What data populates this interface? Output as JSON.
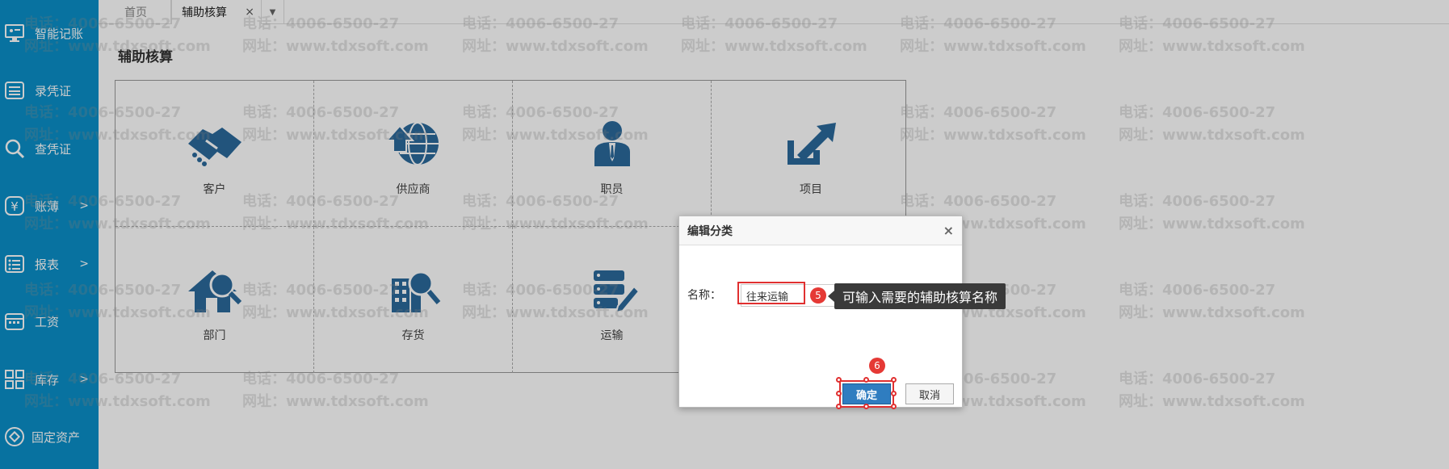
{
  "sidebar": {
    "items": [
      {
        "label": "智能记账",
        "icon": "monitor-icon",
        "arrow": ""
      },
      {
        "label": "录凭证",
        "icon": "voucher-entry-icon",
        "arrow": ""
      },
      {
        "label": "查凭证",
        "icon": "search-icon",
        "arrow": ""
      },
      {
        "label": "账薄",
        "icon": "yen-icon",
        "arrow": ">"
      },
      {
        "label": "报表",
        "icon": "report-icon",
        "arrow": ">"
      },
      {
        "label": "工资",
        "icon": "calendar-icon",
        "arrow": ""
      },
      {
        "label": "库存",
        "icon": "grid-icon",
        "arrow": ">"
      },
      {
        "label": "固定资产",
        "icon": "asset-icon",
        "arrow": ""
      }
    ]
  },
  "tabs": {
    "home": "首页",
    "active": "辅助核算",
    "close": "×",
    "dropdown": "▼"
  },
  "page": {
    "title": "辅助核算",
    "categories": [
      {
        "label": "客户",
        "icon": "handshake-icon"
      },
      {
        "label": "供应商",
        "icon": "globe-icon"
      },
      {
        "label": "职员",
        "icon": "employee-icon"
      },
      {
        "label": "项目",
        "icon": "project-icon"
      },
      {
        "label": "部门",
        "icon": "department-icon"
      },
      {
        "label": "存货",
        "icon": "inventory-icon"
      },
      {
        "label": "运输",
        "icon": "transport-icon"
      }
    ]
  },
  "watermark": {
    "phone": "电话：4006-6500-27",
    "site": "网址：www.tdxsoft.com"
  },
  "dialog": {
    "title": "编辑分类",
    "close": "×",
    "name_label": "名称：",
    "name_value": "往来运输",
    "confirm_label": "确定",
    "cancel_label": "取消"
  },
  "annotations": {
    "step5": "5",
    "step6": "6",
    "tooltip": "可输入需要的辅助核算名称"
  },
  "colors": {
    "sidebar": "#0a8fc8",
    "icon": "#2b6a9c",
    "highlight": "#e03030",
    "primary_button": "#2f7dc0"
  }
}
